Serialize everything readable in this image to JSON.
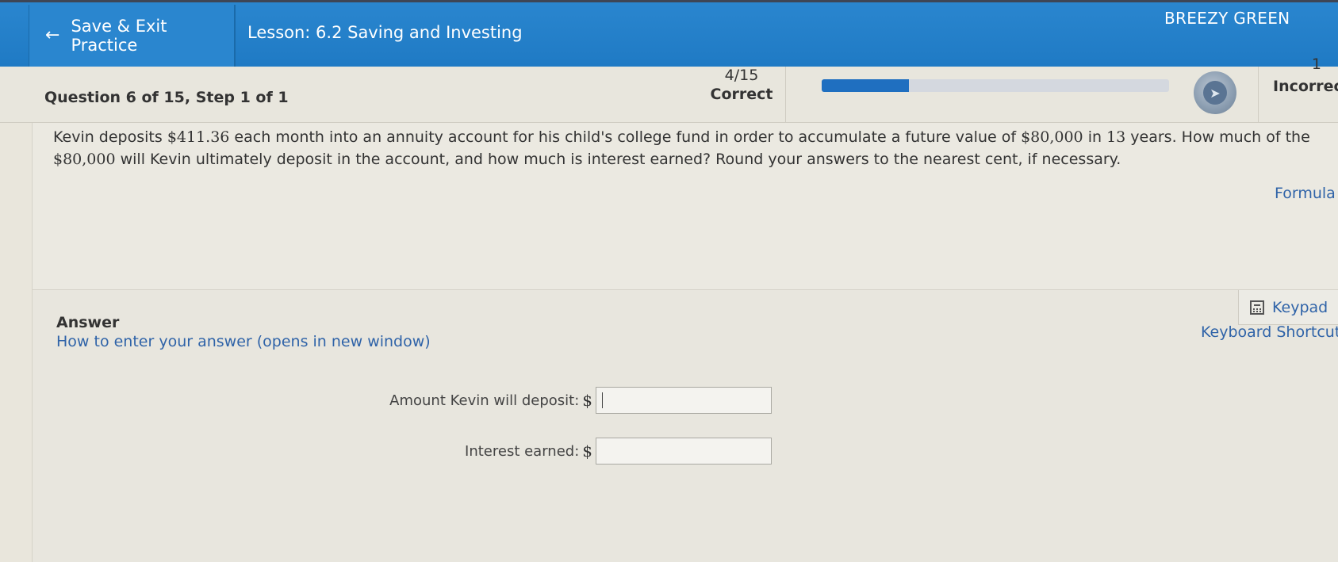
{
  "header": {
    "back_label": "Save & Exit Practice",
    "lesson_title": "Lesson: 6.2 Saving and Investing",
    "user_name": "BREEZY GREEN"
  },
  "status": {
    "question_label": "Question 6 of 15, Step 1 of 1",
    "correct_fraction": "4/15",
    "correct_label": "Correct",
    "progress_fraction": 0.25,
    "incorrect_count": "1",
    "incorrect_label": "Incorrect"
  },
  "question": {
    "text_before_amount": "Kevin deposits ",
    "amount": "$411.36",
    "text_mid1": " each month into an annuity account for his child's college fund in order to accumulate a future value of ",
    "future_value": "$80,000",
    "text_mid2": " in ",
    "years": "13",
    "text_mid3": " years. How much of the ",
    "future_value_2": "$80,000",
    "text_end": " will Kevin ultimately deposit in the account, and how much is interest earned? Round your answers to the nearest cent, if necessary.",
    "formula_link": "Formula"
  },
  "answer": {
    "heading": "Answer",
    "howto_link": "How to enter your answer (opens in new window)",
    "keypad_label": "Keypad",
    "shortcuts_label": "Keyboard Shortcuts",
    "currency_symbol": "$",
    "fields": [
      {
        "label": "Amount Kevin will deposit:",
        "value": ""
      },
      {
        "label": "Interest earned:",
        "value": ""
      }
    ]
  },
  "colors": {
    "header_blue": "#2a86cf",
    "progress_fill": "#1f6fc0",
    "link_blue": "#2f63a8"
  }
}
